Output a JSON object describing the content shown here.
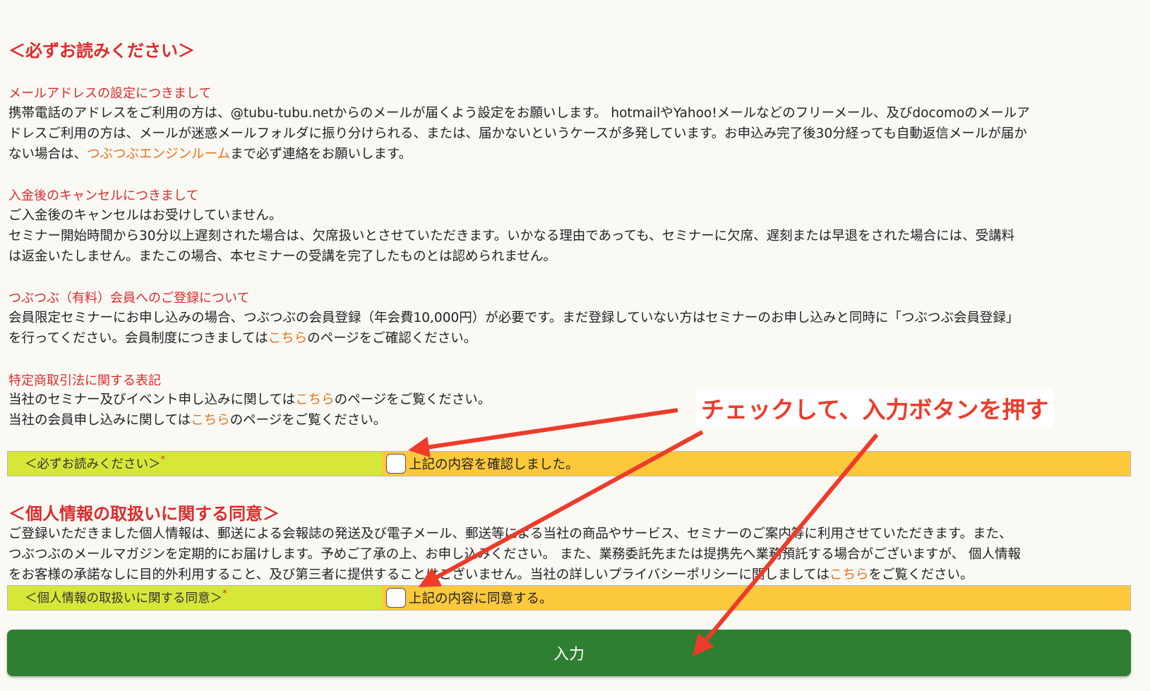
{
  "notice": {
    "heading": "＜必ずお読みください＞",
    "email": {
      "title": "メールアドレスの設定につきまして",
      "line1": "携帯電話のアドレスをご利用の方は、@tubu-tubu.netからのメールが届くよう設定をお願いします。 hotmailやYahoo!メールなどのフリーメール、及びdocomoのメールア",
      "line2": "ドレスご利用の方は、メールが迷惑メールフォルダに振り分けられる、または、届かないというケースが多発しています。お申込み完了後30分経っても自動返信メールが届か",
      "line3_pre": "ない場合は、",
      "line3_link": "つぶつぶエンジンルーム",
      "line3_post": "まで必ず連絡をお願いします。"
    },
    "cancel": {
      "title": "入金後のキャンセルにつきまして",
      "line1": "ご入金後のキャンセルはお受けしていません。",
      "line2": "セミナー開始時間から30分以上遅刻された場合は、欠席扱いとさせていただきます。いかなる理由であっても、セミナーに欠席、遅刻または早退をされた場合には、受講料",
      "line3": "は返金いたしません。またこの場合、本セミナーの受講を完了したものとは認められません。"
    },
    "member": {
      "title": "つぶつぶ（有料）会員へのご登録について",
      "line1": "会員限定セミナーにお申し込みの場合、つぶつぶの会員登録（年会費10,000円）が必要です。まだ登録していない方はセミナーのお申し込みと同時に「つぶつぶ会員登録」",
      "line2_pre": "を行ってください。会員制度につきましては",
      "line2_link": "こちら",
      "line2_post": "のページをご確認ください。"
    },
    "law": {
      "title": "特定商取引法に関する表記",
      "line1_pre": "当社のセミナー及びイベント申し込みに関しては",
      "line1_link": "こちら",
      "line1_post": "のページをご覧ください。",
      "line2_pre": "当社の会員申し込みに関しては",
      "line2_link": "こちら",
      "line2_post": "のページをご覧ください。"
    }
  },
  "confirm_row": {
    "label": "＜必ずお読みください＞",
    "required_mark": "*",
    "checkbox_label": "上記の内容を確認しました。",
    "checked": false
  },
  "privacy": {
    "heading": "＜個人情報の取扱いに関する同意＞",
    "line1": "ご登録いただきました個人情報は、郵送による会報誌の発送及び電子メール、郵送等による当社の商品やサービス、セミナーのご案内等に利用させていただきます。また、",
    "line2": "つぶつぶのメールマガジンを定期的にお届けします。予めご了承の上、お申し込みください。 また、業務委託先または提携先へ業務預託する場合がございますが、 個人情報",
    "line3_pre": "をお客様の承諾なしに目的外利用すること、及び第三者に提供することはございません。当社の詳しいプライバシーポリシーに関しましては",
    "line3_link": "こちら",
    "line3_post": "をご覧ください。"
  },
  "privacy_row": {
    "label": "＜個人情報の取扱いに関する同意＞",
    "required_mark": "*",
    "checkbox_label": "上記の内容に同意する。",
    "checked": false
  },
  "submit_label": "入力",
  "annotation": {
    "text": "チェックして、入力ボタンを押す",
    "color": "#ee3b2a"
  },
  "colors": {
    "accent_red": "#dc2b2b",
    "link_orange": "#e8721d",
    "label_green": "#d6e737",
    "value_yellow": "#fcc83c",
    "button_green": "#2e7f31",
    "background": "#fbf9f4"
  }
}
